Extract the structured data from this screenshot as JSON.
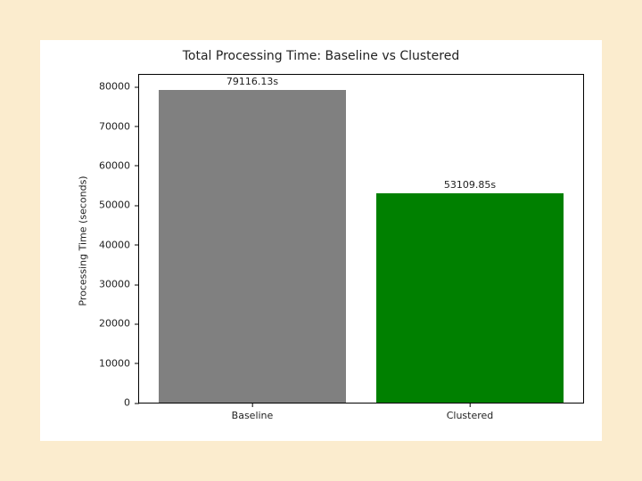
{
  "chart_data": {
    "type": "bar",
    "title": "Total Processing Time: Baseline vs Clustered",
    "ylabel": "Processing Time (seconds)",
    "xlabel": "",
    "categories": [
      "Baseline",
      "Clustered"
    ],
    "values": [
      79116.13,
      53109.85
    ],
    "value_labels": [
      "79116.13s",
      "53109.85s"
    ],
    "colors": [
      "#808080",
      "#008000"
    ],
    "ylim": [
      0,
      83000
    ],
    "yticks": [
      0,
      10000,
      20000,
      30000,
      40000,
      50000,
      60000,
      70000,
      80000
    ],
    "bar_width_frac": 0.42,
    "bar_centers_frac": [
      0.255,
      0.745
    ]
  }
}
